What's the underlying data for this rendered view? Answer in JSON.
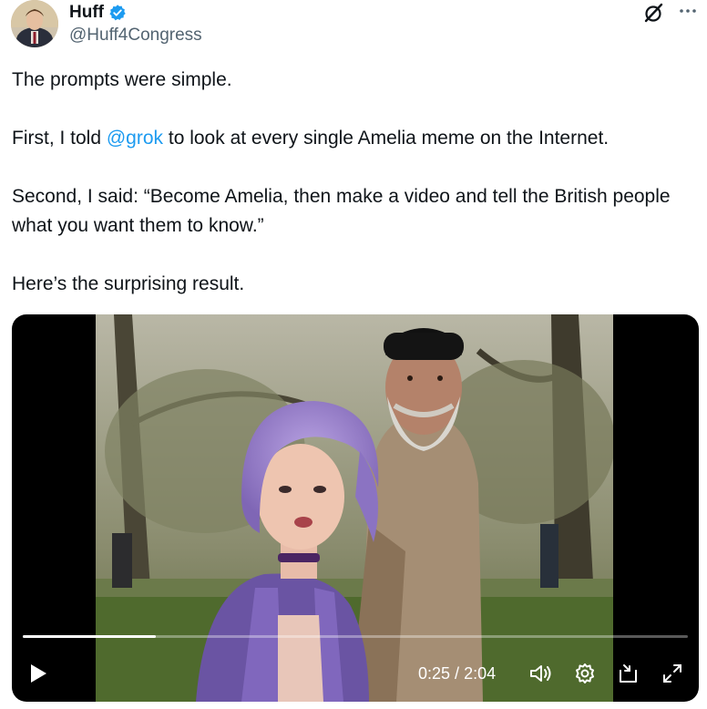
{
  "author": {
    "display_name": "Huff",
    "handle": "@Huff4Congress",
    "verified": true
  },
  "tweet": {
    "p1": "The prompts were simple.",
    "p2_pre": "First, I told ",
    "p2_mention": "@grok",
    "p2_post": " to look at every single Amelia meme on the Internet.",
    "p3": "Second, I said: “Become Amelia, then make a video and tell the British people what you want them to know.”",
    "p4": "Here’s the surprising result."
  },
  "video": {
    "current_time": "0:25",
    "separator": " / ",
    "duration": "2:04",
    "progress": 0.2
  },
  "icons": {
    "verified": "verified-badge-icon",
    "grok": "grok-icon",
    "more": "more-options-icon",
    "play": "play-icon",
    "volume": "volume-icon",
    "settings": "settings-gear-icon",
    "pip": "picture-in-picture-icon",
    "fullscreen": "fullscreen-icon"
  },
  "colors": {
    "link": "#1d9bf0",
    "verified": "#1d9bf0",
    "text": "#0f1419",
    "secondary": "#536471",
    "hair": "#9b82c9"
  }
}
